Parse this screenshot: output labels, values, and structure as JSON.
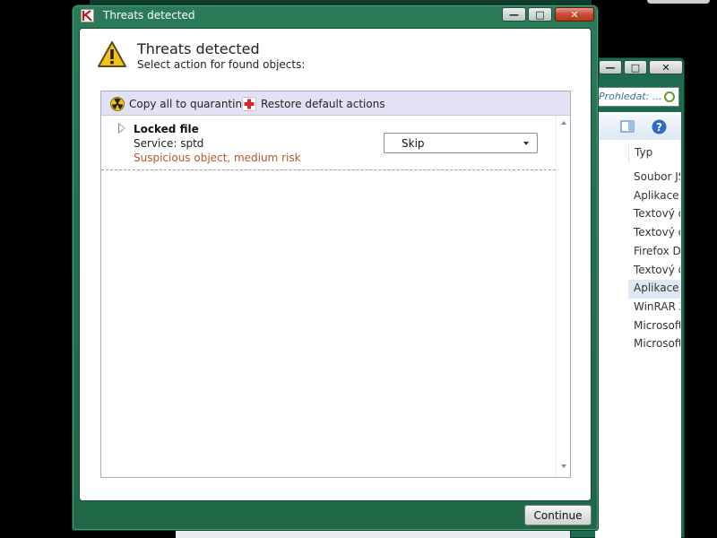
{
  "dialog": {
    "window_title": "Threats detected",
    "heading": "Threats detected",
    "subheading": "Select action for found objects:",
    "toolbar": {
      "quarantine_label": "Copy all to quarantine",
      "restore_label": "Restore default actions"
    },
    "threats": [
      {
        "name": "Locked file",
        "service": "Service: sptd",
        "risk": "Suspicious object, medium risk",
        "action": "Skip"
      }
    ],
    "continue_label": "Continue"
  },
  "background_window": {
    "search_placeholder": "Prohledat: ...",
    "column_header": "Typ",
    "rows": [
      {
        "label": "Soubor JS"
      },
      {
        "label": "Aplikace"
      },
      {
        "label": "Textový d"
      },
      {
        "label": "Textový d"
      },
      {
        "label": "Firefox Do"
      },
      {
        "label": "Textový d"
      },
      {
        "label": "Aplikace",
        "selected": true
      },
      {
        "label": "WinRAR Z"
      },
      {
        "label": "Microsoft"
      },
      {
        "label": "Microsoft"
      }
    ]
  },
  "colors": {
    "titlebar": "#237050",
    "risk_text": "#b8542e",
    "toolbar_bg": "#e3e2f4"
  }
}
